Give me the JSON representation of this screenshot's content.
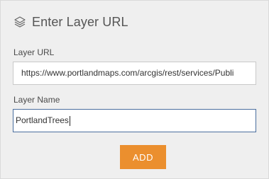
{
  "header": {
    "title": "Enter Layer URL",
    "icon": "layers-icon"
  },
  "form": {
    "url_label": "Layer URL",
    "url_value": "https://www.portlandmaps.com/arcgis/rest/services/Publi­",
    "name_label": "Layer Name",
    "name_value": "PortlandTrees"
  },
  "actions": {
    "add_label": "ADD"
  },
  "colors": {
    "accent": "#eb8f2e",
    "panel_bg": "#efefef",
    "focus_border": "#4a6e9e"
  }
}
